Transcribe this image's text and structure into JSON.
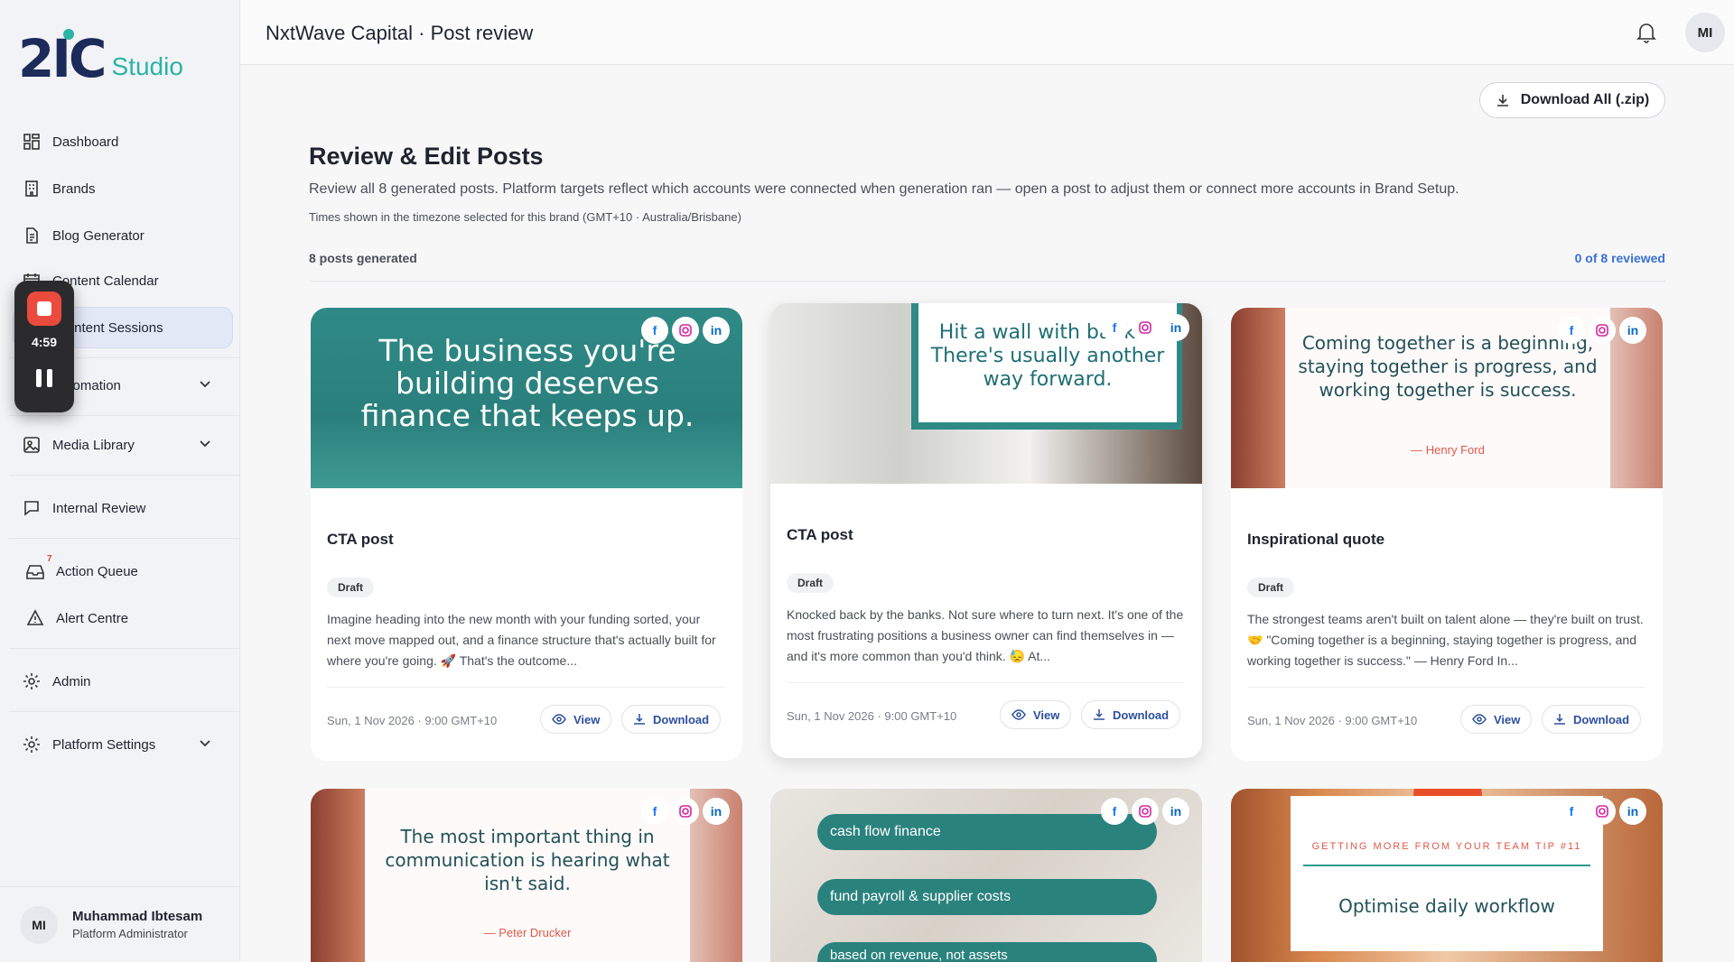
{
  "brand": {
    "logo_mark": "2IC",
    "logo_sub": "Studio"
  },
  "sidebar": {
    "items": [
      {
        "label": "Dashboard"
      },
      {
        "label": "Brands"
      },
      {
        "label": "Blog Generator"
      },
      {
        "label": "Content Calendar"
      },
      {
        "label": "Content Sessions"
      },
      {
        "label": "Automation"
      },
      {
        "label": "Media Library"
      },
      {
        "label": "Internal Review"
      },
      {
        "label": "Action Queue",
        "badge": "7"
      },
      {
        "label": "Alert Centre"
      },
      {
        "label": "Admin"
      },
      {
        "label": "Platform Settings"
      }
    ],
    "user": {
      "initials": "MI",
      "name": "Muhammad Ibtesam",
      "role": "Platform Administrator"
    }
  },
  "recorder": {
    "time": "4:59"
  },
  "header": {
    "title": "NxtWave Capital · Post review",
    "avatar": "MI"
  },
  "main": {
    "download_all": "Download All (.zip)",
    "title": "Review & Edit Posts",
    "description": "Review all 8 generated posts. Platform targets reflect which accounts were connected when generation ran — open a post to adjust them or connect more accounts in Brand Setup.",
    "timezone_note": "Times shown in the timezone selected for this brand (GMT+10 · Australia/Brisbane)",
    "posts_count": "8 posts generated",
    "reviewed_count": "0 of 8 reviewed"
  },
  "cards": [
    {
      "image_text": "The business you're building deserves finance that keeps up.",
      "title": "CTA post",
      "status": "Draft",
      "body": "Imagine heading into the new month with your funding sorted, your next move mapped out, and a finance structure that's actually built for where you're going. 🚀 That's the outcome...",
      "date": "Sun, 1 Nov 2026 · 9:00 GMT+10",
      "view": "View",
      "download": "Download"
    },
    {
      "image_text": "Hit a wall with banks? There's usually another way forward.",
      "title": "CTA post",
      "status": "Draft",
      "body": "Knocked back by the banks. Not sure where to turn next. It's one of the most frustrating positions a business owner can find themselves in — and it's more common than you'd think. 😓 At...",
      "date": "Sun, 1 Nov 2026 · 9:00 GMT+10",
      "view": "View",
      "download": "Download"
    },
    {
      "image_text": "Coming together is a beginning, staying together is progress, and working together is success.",
      "image_author": "— Henry Ford",
      "title": "Inspirational quote",
      "status": "Draft",
      "body": "The strongest teams aren't built on talent alone — they're built on trust. 🤝 \"Coming together is a beginning, staying together is progress, and working together is success.\" — Henry Ford In...",
      "date": "Sun, 1 Nov 2026 · 9:00 GMT+10",
      "view": "View",
      "download": "Download"
    },
    {
      "image_text": "The most important thing in communication is hearing what isn't said.",
      "image_author": "— Peter Drucker"
    },
    {
      "pills": [
        "cash flow finance",
        "fund payroll & supplier costs",
        "based on revenue, not assets"
      ]
    },
    {
      "tip_label": "GETTING MORE FROM YOUR TEAM TIP #11",
      "image_text": "Optimise daily workflow"
    }
  ],
  "icons": {
    "fb": "facebook-icon",
    "ig": "instagram-icon",
    "li": "linkedin-icon"
  },
  "colors": {
    "accent": "#2bb3a6",
    "teal": "#2f8a86",
    "link": "#3b6fd6",
    "record": "#ea4b3d"
  }
}
